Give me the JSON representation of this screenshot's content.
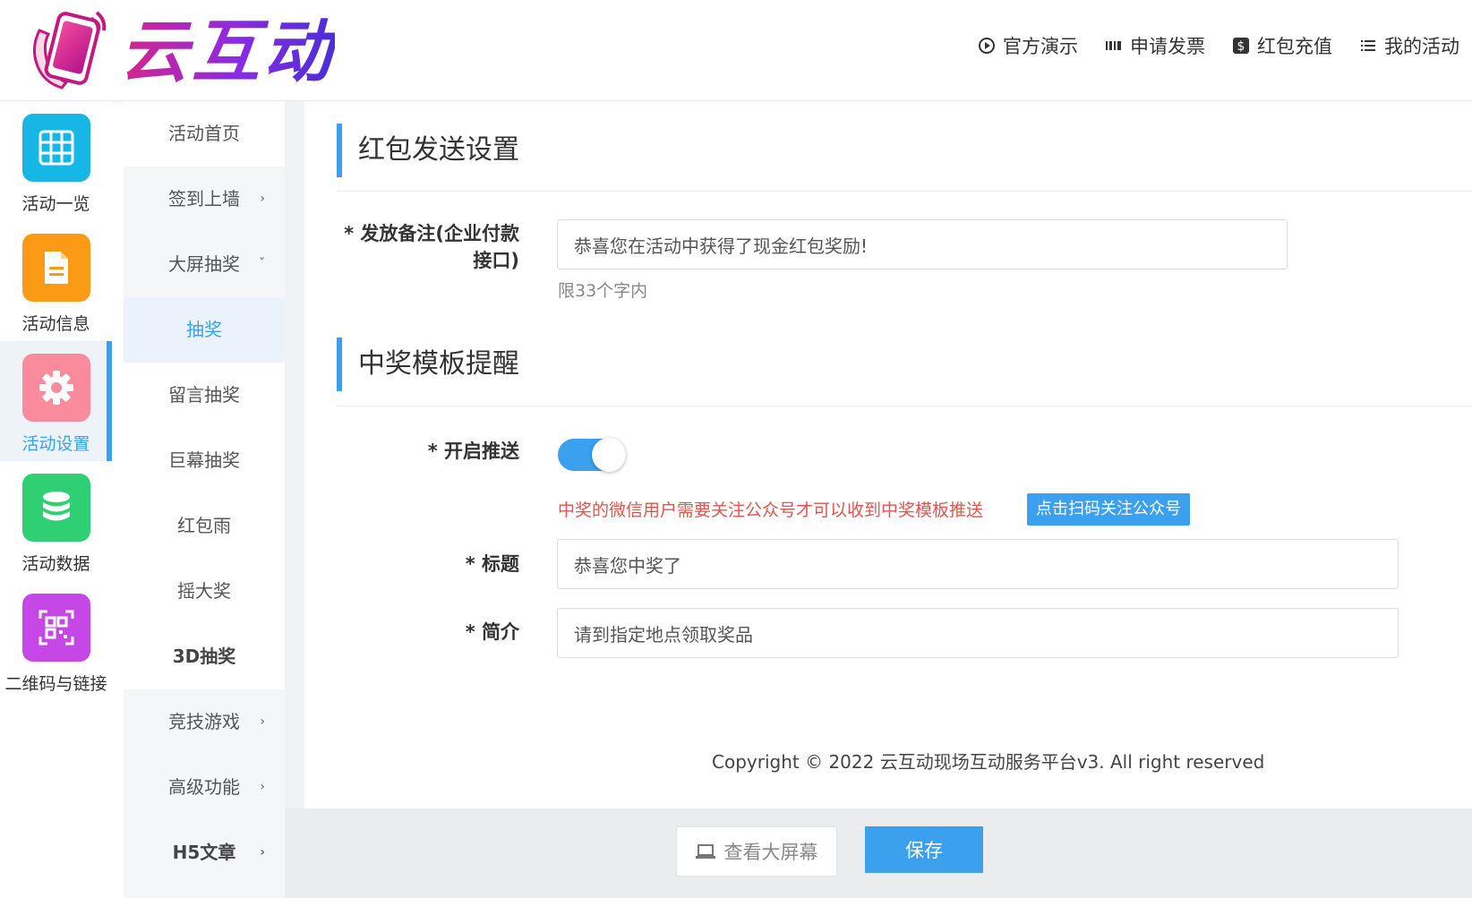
{
  "brand": {
    "name": "云互动"
  },
  "topnav": [
    {
      "label": "官方演示",
      "icon": "play-circle-icon"
    },
    {
      "label": "申请发票",
      "icon": "barcode-icon"
    },
    {
      "label": "红包充值",
      "icon": "dollar-icon"
    },
    {
      "label": "我的活动",
      "icon": "list-icon"
    }
  ],
  "iconbar": [
    {
      "label": "活动一览",
      "icon": "grid-icon",
      "color": "#16b7e5",
      "active": false
    },
    {
      "label": "活动信息",
      "icon": "document-icon",
      "color": "#fb9a14",
      "active": false
    },
    {
      "label": "活动设置",
      "icon": "gear-icon",
      "color": "#f98b9c",
      "active": true
    },
    {
      "label": "活动数据",
      "icon": "database-icon",
      "color": "#2fcf73",
      "active": false
    },
    {
      "label": "二维码与链接",
      "icon": "qrcode-icon",
      "color": "#c447e6",
      "active": false
    }
  ],
  "submenu": [
    {
      "label": "活动首页",
      "chevron": ""
    },
    {
      "label": "签到上墙",
      "chevron": "›"
    },
    {
      "label": "大屏抽奖",
      "chevron": "ˇ"
    },
    {
      "label": "抽奖",
      "chevron": ""
    },
    {
      "label": "留言抽奖",
      "chevron": ""
    },
    {
      "label": "巨幕抽奖",
      "chevron": ""
    },
    {
      "label": "红包雨",
      "chevron": ""
    },
    {
      "label": "摇大奖",
      "chevron": ""
    },
    {
      "label": "3D抽奖",
      "chevron": ""
    },
    {
      "label": "竞技游戏",
      "chevron": "›"
    },
    {
      "label": "高级功能",
      "chevron": "›"
    },
    {
      "label": "H5文章",
      "chevron": "›"
    }
  ],
  "section1": {
    "title": "红包发送设置",
    "remark_label_1": "* 发放备注(企业付款",
    "remark_label_2": "接口)",
    "remark_value": "恭喜您在活动中获得了现金红包奖励!",
    "remark_hint": "限33个字内"
  },
  "section2": {
    "title": "中奖模板提醒",
    "push_label": "* 开启推送",
    "push_enabled": true,
    "warning": "中奖的微信用户需要关注公众号才可以收到中奖模板推送",
    "follow_button": "点击扫码关注公众号",
    "title_label": "* 标题",
    "title_value": "恭喜您中奖了",
    "intro_label": "* 简介",
    "intro_value": "请到指定地点领取奖品"
  },
  "footer": {
    "copyright": "Copyright © 2022 云互动现场互动服务平台v3. All right reserved"
  },
  "bottombar": {
    "view_label": "查看大屏幕",
    "save_label": "保存"
  },
  "colors": {
    "accent": "#3ba1ee",
    "warning": "#e0554f"
  }
}
